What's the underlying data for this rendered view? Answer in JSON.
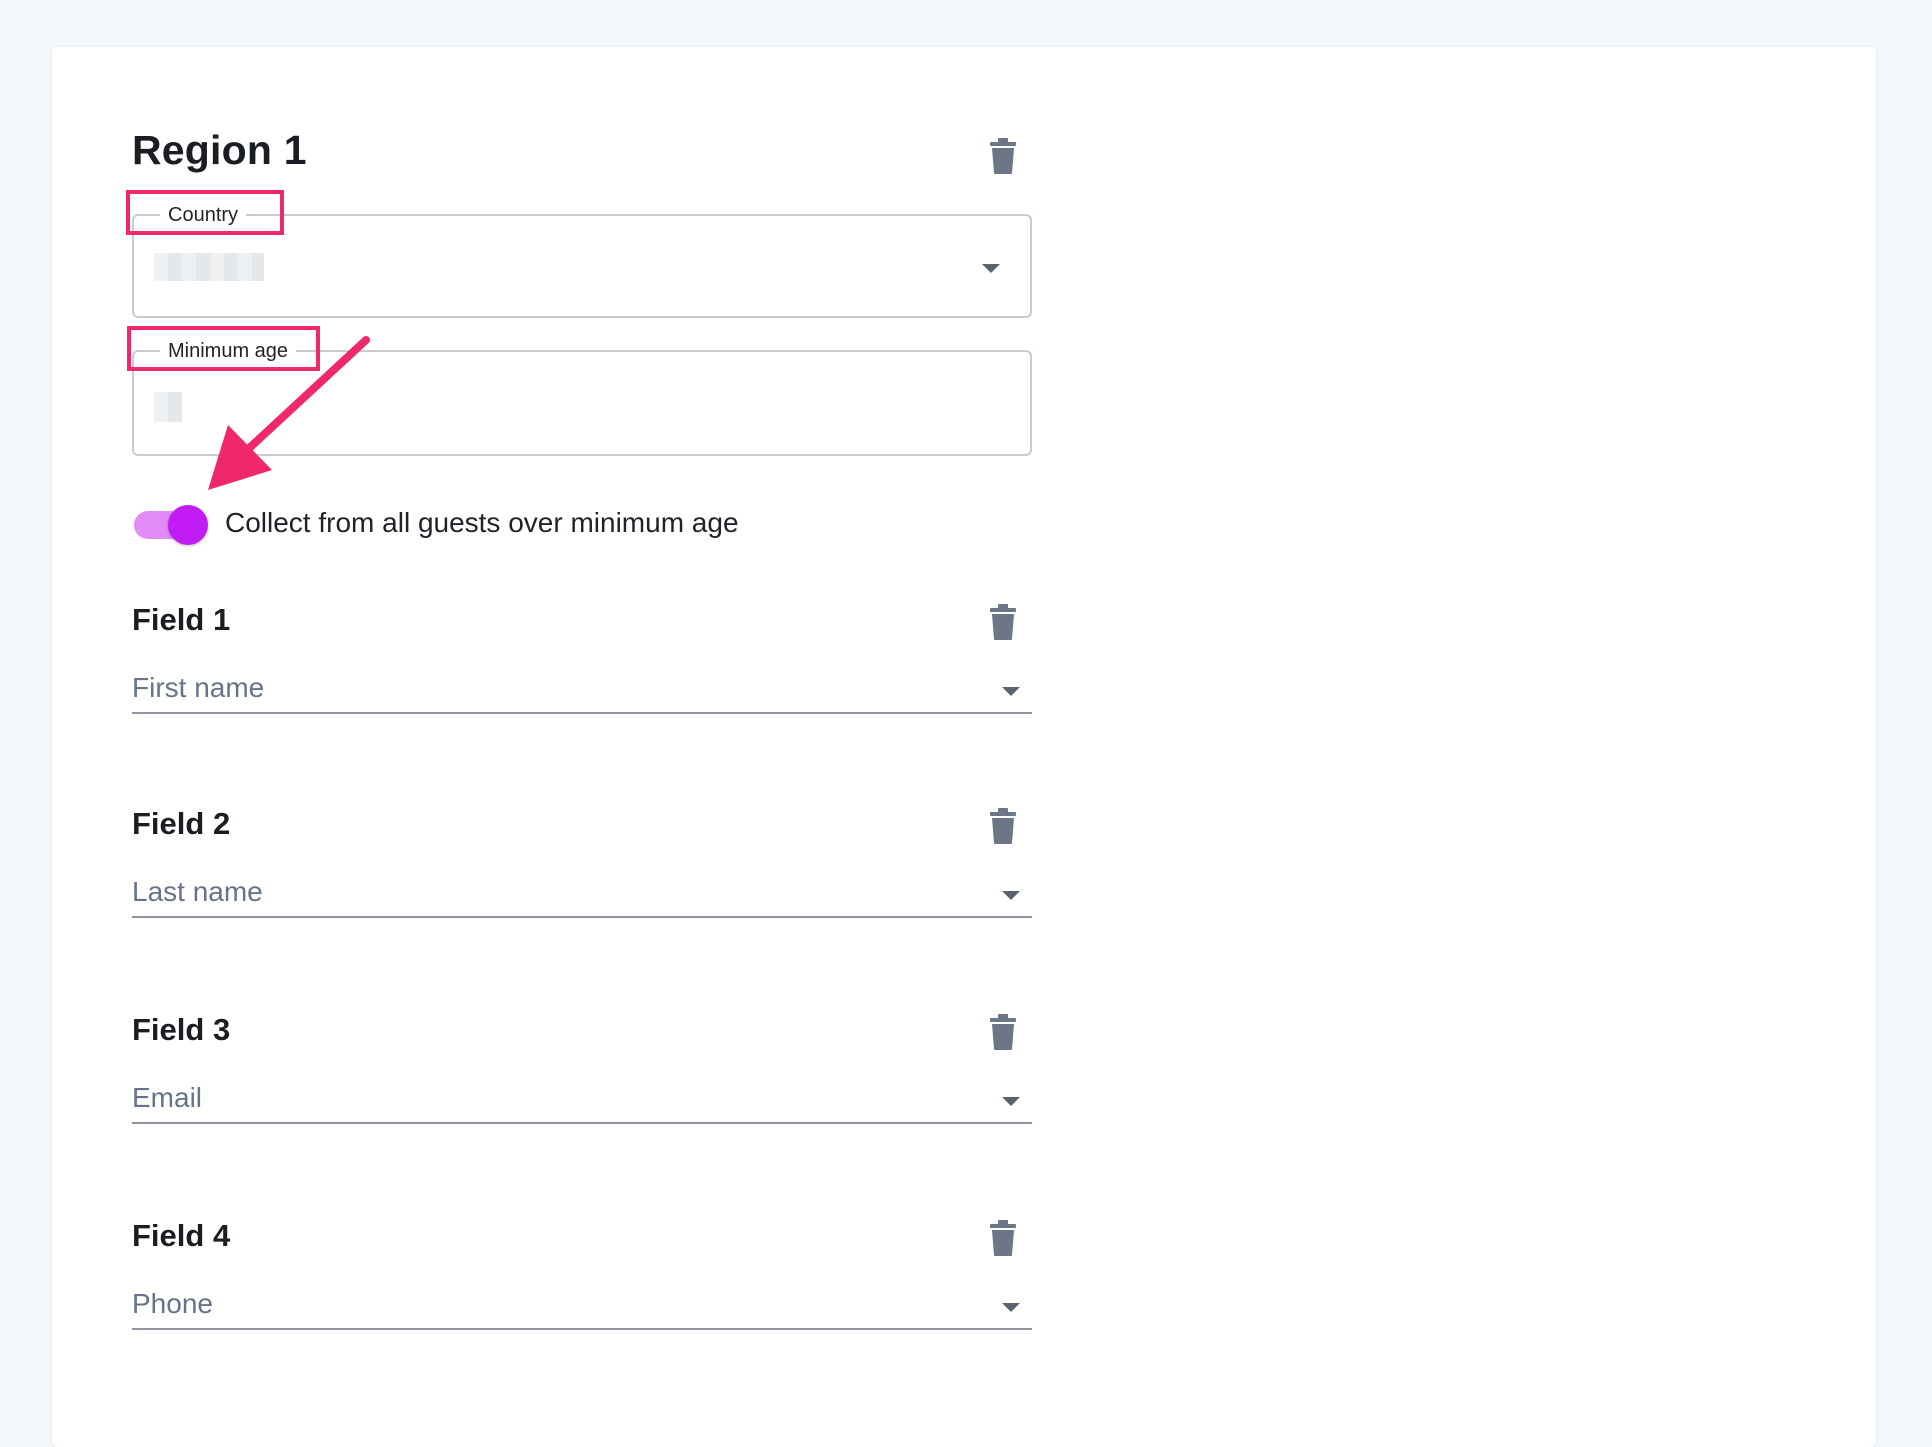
{
  "region": {
    "title": "Region 1",
    "delete_icon": "trash-icon"
  },
  "country": {
    "label": "Country",
    "value_redacted": true,
    "dropdown_icon": "chevron-down-icon"
  },
  "minimum_age": {
    "label": "Minimum age",
    "value_redacted": true
  },
  "toggle": {
    "label": "Collect from all guests over minimum age",
    "checked": true,
    "track_color": "#e28af5",
    "knob_color": "#c11cf5"
  },
  "annotation": {
    "highlight_color": "#f0276a",
    "arrow_color": "#f0276a"
  },
  "fields": [
    {
      "title": "Field 1",
      "value": "First name"
    },
    {
      "title": "Field 2",
      "value": "Last name"
    },
    {
      "title": "Field 3",
      "value": "Email"
    },
    {
      "title": "Field 4",
      "value": "Phone"
    }
  ]
}
